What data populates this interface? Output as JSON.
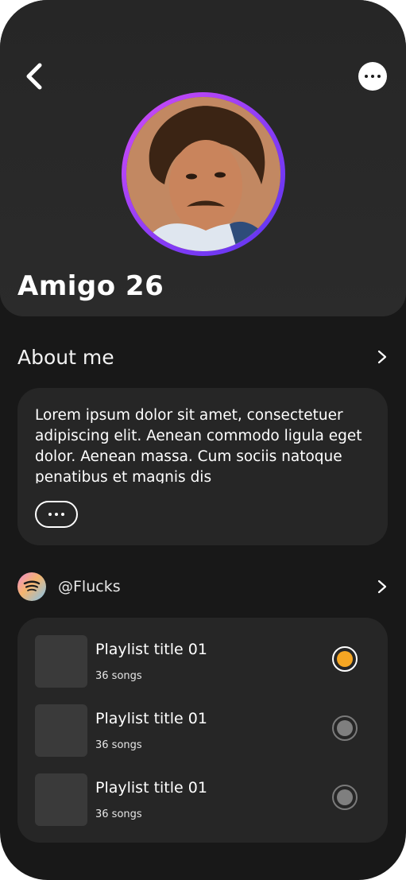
{
  "profile": {
    "name": "Amigo 26"
  },
  "about": {
    "title": "About me",
    "text": "Lorem ipsum dolor sit amet, consectetuer adipiscing elit. Aenean commodo ligula eget dolor. Aenean massa. Cum sociis natoque penatibus et magnis dis"
  },
  "spotify": {
    "handle": "@Flucks"
  },
  "playlists": [
    {
      "title": "Playlist title 01",
      "count": "36 songs",
      "selected": true
    },
    {
      "title": "Playlist title 01",
      "count": "36 songs",
      "selected": false
    },
    {
      "title": "Playlist title 01",
      "count": "36 songs",
      "selected": false
    }
  ],
  "colors": {
    "background": "#181818",
    "card": "#262626",
    "accent_selected": "#f5a623",
    "avatar_ring_start": "#d44cf5",
    "avatar_ring_end": "#5a35f0"
  },
  "icons": [
    "back-chevron-icon",
    "more-dots-icon",
    "chevron-right-icon",
    "spotify-icon"
  ]
}
